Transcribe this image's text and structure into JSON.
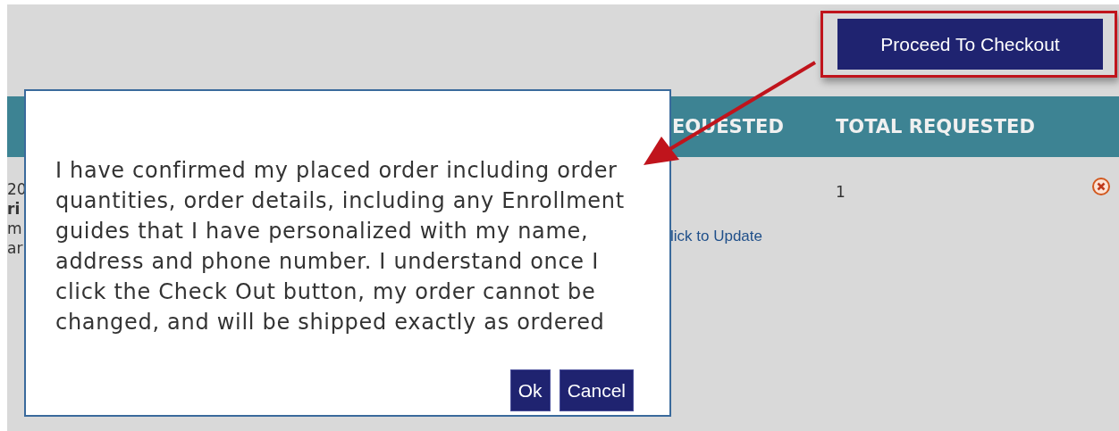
{
  "checkout_button": {
    "label": "Proceed To Checkout",
    "highlighted": true
  },
  "table": {
    "columns": [
      "EQUESTED",
      "TOTAL REQUESTED"
    ],
    "left_fragments": [
      "20",
      "ri",
      "m",
      "ar"
    ],
    "row": {
      "update_link": "lick to Update",
      "total": "1"
    }
  },
  "dialog": {
    "message": "I have confirmed my placed order including order quantities, order details, including any Enrollment guides that I have personalized with my name, address and phone number. I understand once I click the Check Out button, my order cannot be changed, and will be shipped exactly as ordered",
    "buttons": [
      "Ok",
      "Cancel"
    ]
  }
}
